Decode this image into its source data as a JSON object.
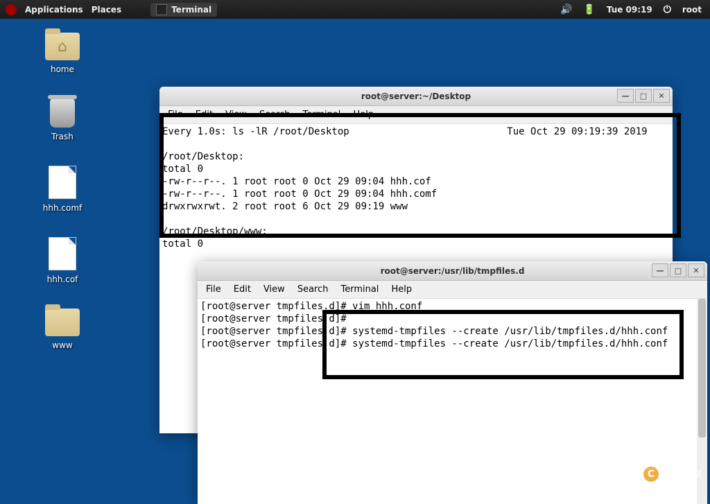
{
  "topbar": {
    "applications": "Applications",
    "places": "Places",
    "task_terminal": "Terminal",
    "clock": "Tue 09:19",
    "user": "root"
  },
  "desktop_icons": {
    "home": "home",
    "trash": "Trash",
    "hhh_comf": "hhh.comf",
    "hhh_cof": "hhh.cof",
    "www": "www"
  },
  "menubar": {
    "file": "File",
    "edit": "Edit",
    "view": "View",
    "search": "Search",
    "terminal": "Terminal",
    "help": "Help"
  },
  "win1": {
    "title": "root@server:~/Desktop",
    "body": "Every 1.0s: ls -lR /root/Desktop                           Tue Oct 29 09:19:39 2019\n\n/root/Desktop:\ntotal 0\n-rw-r--r--. 1 root root 0 Oct 29 09:04 hhh.cof\n-rw-r--r--. 1 root root 0 Oct 29 09:04 hhh.comf\ndrwxrwxrwt. 2 root root 6 Oct 29 09:19 www\n\n/root/Desktop/www:\ntotal 0"
  },
  "win2": {
    "title": "root@server:/usr/lib/tmpfiles.d",
    "body": "[root@server tmpfiles.d]# vim hhh.conf\n[root@server tmpfiles.d]# \n[root@server tmpfiles.d]# systemd-tmpfiles --create /usr/lib/tmpfiles.d/hhh.conf\n[root@server tmpfiles.d]# systemd-tmpfiles --create /usr/lib/tmpfiles.d/hhh.conf"
  },
  "watermark": "创新互联"
}
